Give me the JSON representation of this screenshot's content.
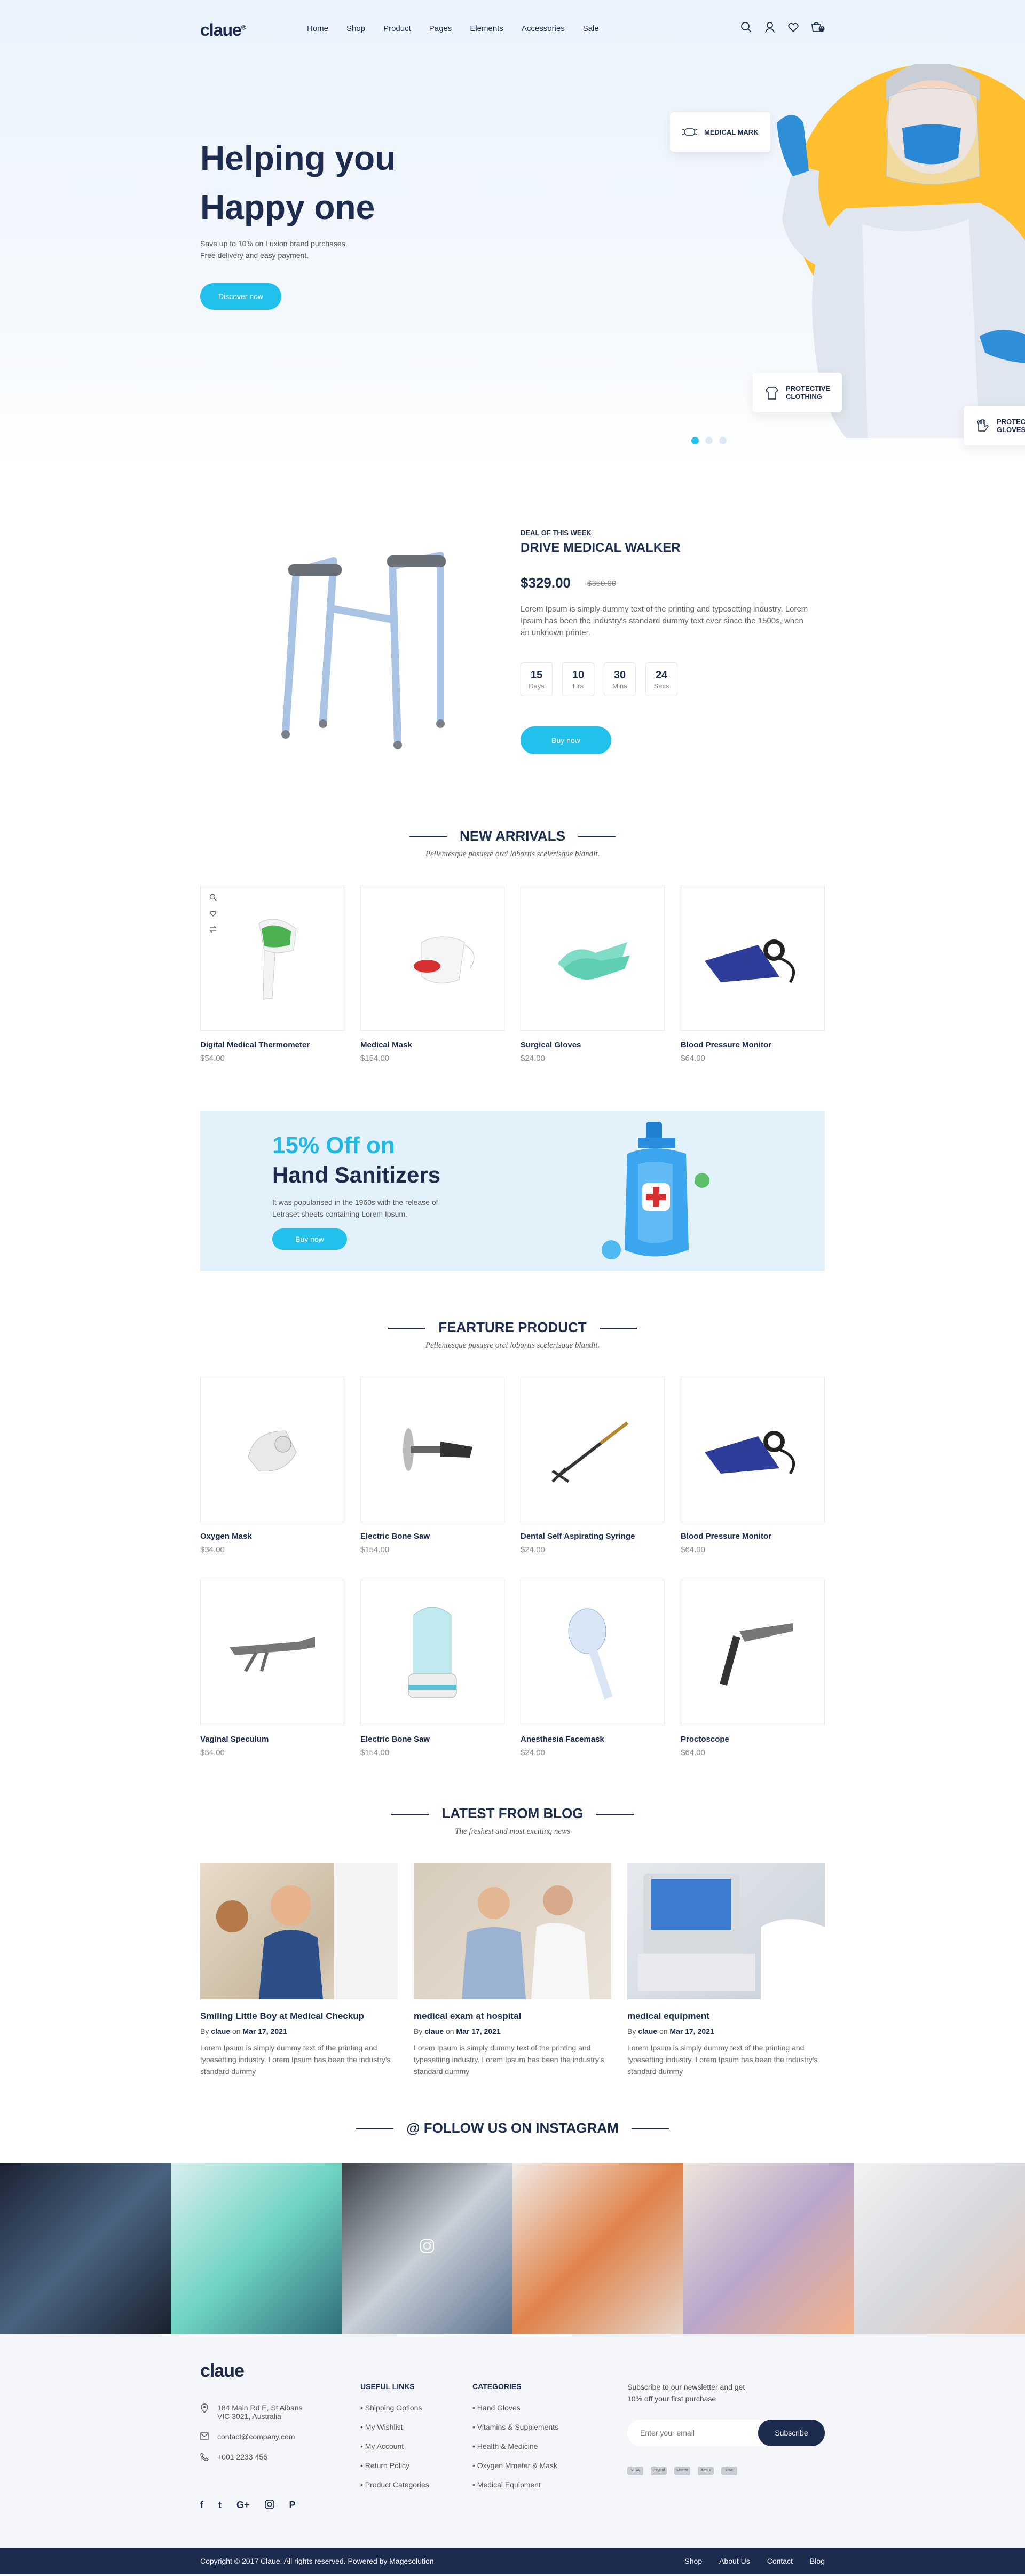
{
  "header": {
    "logo": "claue",
    "logo_mark": "®",
    "nav": [
      "Home",
      "Shop",
      "Product",
      "Pages",
      "Elements",
      "Accessories",
      "Sale"
    ],
    "cart_count": "0"
  },
  "hero": {
    "title_line1": "Helping you",
    "title_line2": "Happy one",
    "subtitle_line1": "Save up to 10% on Luxion brand purchases.",
    "subtitle_line2": "Free delivery and easy payment.",
    "button": "Discover now",
    "chip_mask": "MEDICAL MARK",
    "chip_clothing": "PROTECTIVE CLOTHING",
    "chip_gloves": "PROTECTIVE GLOVES"
  },
  "deal": {
    "tag": "DEAL OF THIS WEEK",
    "title": "DRIVE MEDICAL WALKER",
    "price": "$329.00",
    "old_price": "$350.00",
    "description": "Lorem Ipsum is simply dummy text of the printing and typesetting industry. Lorem Ipsum has been the industry's standard dummy text ever since the 1500s, when an unknown printer.",
    "countdown": [
      {
        "value": "15",
        "unit": "Days"
      },
      {
        "value": "10",
        "unit": "Hrs"
      },
      {
        "value": "30",
        "unit": "Mins"
      },
      {
        "value": "24",
        "unit": "Secs"
      }
    ],
    "button": "Buy now"
  },
  "new_arrivals": {
    "title": "NEW ARRIVALS",
    "subtitle": "Pellentesque posuere orci lobortis scelerisque blandit.",
    "products": [
      {
        "name": "Digital Medical Thermometer",
        "price": "$54.00"
      },
      {
        "name": "Medical Mask",
        "price": "$154.00"
      },
      {
        "name": "Surgical Gloves",
        "price": "$24.00"
      },
      {
        "name": "Blood Pressure Monitor",
        "price": "$64.00"
      }
    ]
  },
  "promo": {
    "line1": "15% Off on",
    "line2": "Hand Sanitizers",
    "desc": "It was popularised in the 1960s with the release of Letraset sheets containing Lorem Ipsum.",
    "button": "Buy now"
  },
  "featured": {
    "title": "FEARTURE PRODUCT",
    "subtitle": "Pellentesque posuere orci lobortis scelerisque blandit.",
    "products": [
      {
        "name": "Oxygen Mask",
        "price": "$34.00"
      },
      {
        "name": "Electric Bone Saw",
        "price": "$154.00"
      },
      {
        "name": "Dental Self Aspirating Syringe",
        "price": "$24.00"
      },
      {
        "name": "Blood Pressure Monitor",
        "price": "$64.00"
      },
      {
        "name": "Vaginal Speculum",
        "price": "$54.00"
      },
      {
        "name": "Electric Bone Saw",
        "price": "$154.00"
      },
      {
        "name": "Anesthesia Facemask",
        "price": "$24.00"
      },
      {
        "name": "Proctoscope",
        "price": "$64.00"
      }
    ]
  },
  "blog": {
    "title": "LATEST FROM BLOG",
    "subtitle": "The freshest and most exciting news",
    "by": "By",
    "on": "on",
    "posts": [
      {
        "title": "Smiling Little Boy at Medical Checkup",
        "author": "claue",
        "date": "Mar 17, 2021",
        "desc": "Lorem Ipsum is simply dummy text of the printing and typesetting industry. Lorem Ipsum has been the industry's standard dummy"
      },
      {
        "title": "medical exam at hospital",
        "author": "claue",
        "date": "Mar 17, 2021",
        "desc": "Lorem Ipsum is simply dummy text of the printing and typesetting industry. Lorem Ipsum has been the industry's standard dummy"
      },
      {
        "title": "medical equipment",
        "author": "claue",
        "date": "Mar 17, 2021",
        "desc": "Lorem Ipsum is simply dummy text of the printing and typesetting industry. Lorem Ipsum has been the industry's standard dummy"
      }
    ]
  },
  "instagram": {
    "title": "@ FOLLOW US ON INSTAGRAM"
  },
  "footer": {
    "logo": "claue",
    "address_line1": "184 Main Rd E, St Albans",
    "address_line2": "VIC 3021, Australia",
    "email": "contact@company.com",
    "phone": "+001 2233 456",
    "useful_title": "USEFUL LINKS",
    "useful_links": [
      "Shipping Options",
      "My Wishlist",
      "My Account",
      "Return Policy",
      "Product Categories"
    ],
    "categories_title": "CATEGORIES",
    "categories": [
      "Hand Gloves",
      "Vitamins & Supplements",
      "Health & Medicine",
      "Oxygen Mmeter & Mask",
      "Medical Equipment"
    ],
    "newsletter_line1": "Subscribe to our newsletter and get",
    "newsletter_line2": "10% off your first purchase",
    "email_placeholder": "Enter your email",
    "subscribe": "Subscribe",
    "payments": [
      "VISA",
      "PayPal",
      "Master",
      "AmEx",
      "Disc"
    ]
  },
  "bottom": {
    "copyright": "Copyright © 2017 Claue. All rights reserved. Powered by Magesolution",
    "links": [
      "Shop",
      "About Us",
      "Contact",
      "Blog"
    ]
  },
  "colors": {
    "navy": "#1d2b4f",
    "accent": "#22c1ec",
    "yellow": "#ffbf2f",
    "promo_bg": "#e3f1fb"
  }
}
